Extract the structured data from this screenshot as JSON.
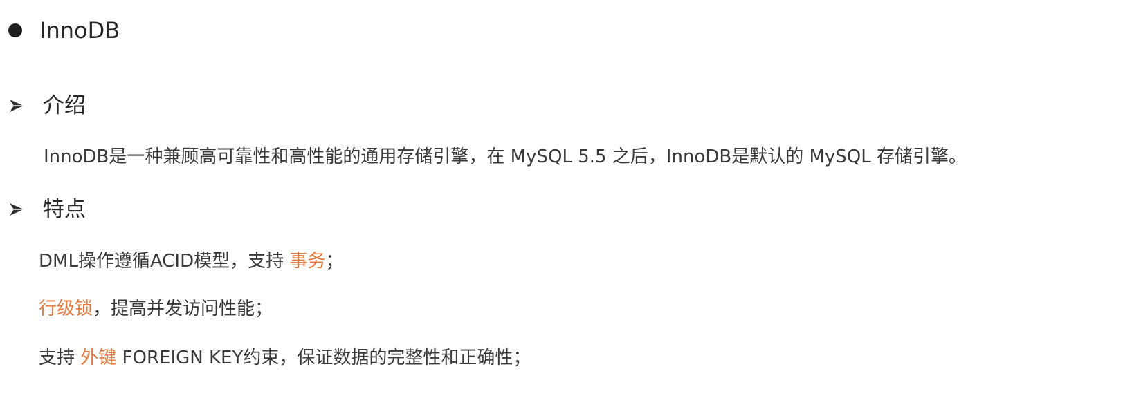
{
  "heading": {
    "icon": "bullet-dot-icon",
    "title": "InnoDB"
  },
  "sections": [
    {
      "icon": "arrow-right-icon",
      "title": "介绍",
      "lines": [
        "InnoDB是一种兼顾高可靠性和高性能的通用存储引擎，在 MySQL 5.5 之后，InnoDB是默认的 MySQL 存储引擎。"
      ]
    },
    {
      "icon": "arrow-right-icon",
      "title": "特点",
      "lines": [
        {
          "before": "DML操作遵循ACID模型，支持 ",
          "highlight": "事务",
          "after": "；"
        },
        {
          "before": "",
          "highlight": "行级锁",
          "after": "，提高并发访问性能；"
        },
        {
          "before": "支持 ",
          "highlight": "外键",
          "after": " FOREIGN KEY约束，保证数据的完整性和正确性；"
        }
      ]
    }
  ],
  "colors": {
    "highlight": "#e8793e",
    "text": "#3a3a3a",
    "heading": "#262626"
  }
}
